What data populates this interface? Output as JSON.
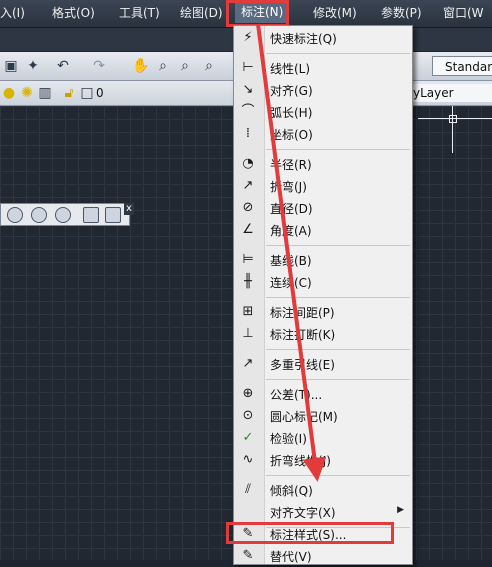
{
  "menubar": {
    "items": [
      {
        "label": "输入(I)",
        "display": "入(I)"
      },
      {
        "label": "格式(O)"
      },
      {
        "label": "工具(T)"
      },
      {
        "label": "绘图(D)"
      },
      {
        "label": "标注(N)"
      },
      {
        "label": "修改(M)"
      },
      {
        "label": "参数(P)"
      },
      {
        "label": "窗口(W"
      }
    ]
  },
  "toolbar": {
    "text_style": "Standar",
    "layer_value": "0",
    "color_value": "yLayer"
  },
  "float_toolbar": {
    "close_label": "x"
  },
  "dim_menu": {
    "items": [
      {
        "label": "快速标注(Q)",
        "icon": "quick-dimension-icon",
        "glyph": "⚡"
      },
      {
        "label": "线性(L)",
        "icon": "linear-icon",
        "glyph": "⊢"
      },
      {
        "label": "对齐(G)",
        "icon": "aligned-icon",
        "glyph": "↘"
      },
      {
        "label": "弧长(H)",
        "icon": "arc-length-icon",
        "glyph": "⌒"
      },
      {
        "label": "坐标(O)",
        "icon": "ordinate-icon",
        "glyph": "⁞"
      },
      {
        "label": "半径(R)",
        "icon": "radius-icon",
        "glyph": "◔"
      },
      {
        "label": "折弯(J)",
        "icon": "jogged-icon",
        "glyph": "↗"
      },
      {
        "label": "直径(D)",
        "icon": "diameter-icon",
        "glyph": "⊘"
      },
      {
        "label": "角度(A)",
        "icon": "angular-icon",
        "glyph": "∠"
      },
      {
        "label": "基线(B)",
        "icon": "baseline-icon",
        "glyph": "⊨"
      },
      {
        "label": "连续(C)",
        "icon": "continue-icon",
        "glyph": "╫"
      },
      {
        "label": "标注间距(P)",
        "icon": "dim-space-icon",
        "glyph": "⊞"
      },
      {
        "label": "标注打断(K)",
        "icon": "dim-break-icon",
        "glyph": "⊥"
      },
      {
        "label": "多重引线(E)",
        "icon": "multileader-icon",
        "glyph": "↗"
      },
      {
        "label": "公差(T)...",
        "icon": "tolerance-icon",
        "glyph": "⊕"
      },
      {
        "label": "圆心标记(M)",
        "icon": "center-mark-icon",
        "glyph": "⊙"
      },
      {
        "label": "检验(I)",
        "icon": "inspection-icon",
        "glyph": "✓"
      },
      {
        "label": "折弯线性(J)",
        "icon": "jogged-linear-icon",
        "glyph": "∿"
      },
      {
        "label": "倾斜(Q)",
        "icon": "oblique-icon",
        "glyph": "⫽"
      },
      {
        "label": "对齐文字(X)",
        "icon": "",
        "glyph": "",
        "submenu": "▶"
      },
      {
        "label": "标注样式(S)...",
        "icon": "dim-style-icon",
        "glyph": "✎"
      },
      {
        "label": "替代(V)",
        "icon": "override-icon",
        "glyph": "✎"
      }
    ]
  },
  "colors": {
    "highlight": "#e23b3b",
    "canvas": "#212832",
    "menu_bg": "#f0f0f0"
  }
}
